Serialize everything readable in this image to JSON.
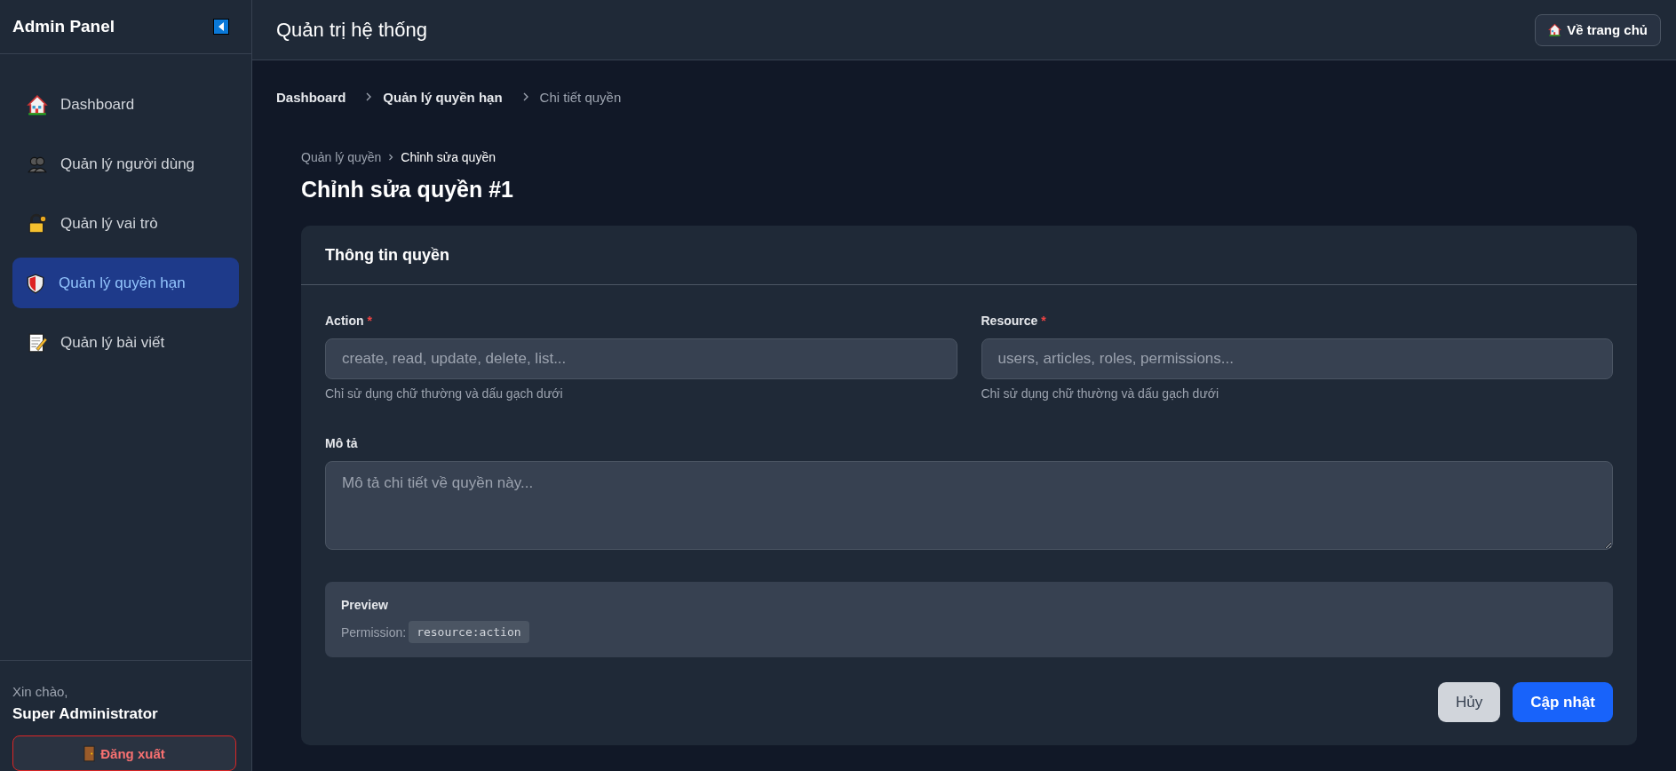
{
  "sidebar": {
    "title": "Admin Panel",
    "items": [
      {
        "label": "Dashboard",
        "selected": false
      },
      {
        "label": "Quản lý người dùng",
        "selected": false
      },
      {
        "label": "Quản lý vai trò",
        "selected": false
      },
      {
        "label": "Quản lý quyền hạn",
        "selected": true
      },
      {
        "label": "Quản lý bài viết",
        "selected": false
      }
    ],
    "greeting": "Xin chào,",
    "user": "Super Administrator",
    "logout": "Đăng xuất"
  },
  "header": {
    "title": "Quản trị hệ thống",
    "home_button": "Về trang chủ"
  },
  "breadcrumb": [
    {
      "label": "Dashboard"
    },
    {
      "label": "Quản lý quyền hạn"
    },
    {
      "label": "Chi tiết quyền"
    }
  ],
  "sub_breadcrumb": [
    "Quản lý quyền",
    "Chỉnh sửa quyền"
  ],
  "page_title": "Chỉnh sửa quyền #1",
  "card": {
    "title": "Thông tin quyền",
    "fields": [
      {
        "label": "Action",
        "required_mark": "*",
        "placeholder": "create, read, update, delete, list...",
        "hint": "Chỉ sử dụng chữ thường và dấu gạch dưới"
      },
      {
        "label": "Resource",
        "required_mark": "*",
        "placeholder": "users, articles, roles, permissions...",
        "hint": "Chỉ sử dụng chữ thường và dấu gạch dưới"
      }
    ],
    "description": {
      "label": "Mô tả",
      "placeholder": "Mô tả chi tiết về quyền này..."
    },
    "preview": {
      "title": "Preview",
      "label": "Permission:",
      "code": "resource:action"
    },
    "buttons": [
      {
        "label": "Hủy",
        "kind": "secondary"
      },
      {
        "label": "Cập nhật",
        "kind": "primary"
      }
    ]
  }
}
